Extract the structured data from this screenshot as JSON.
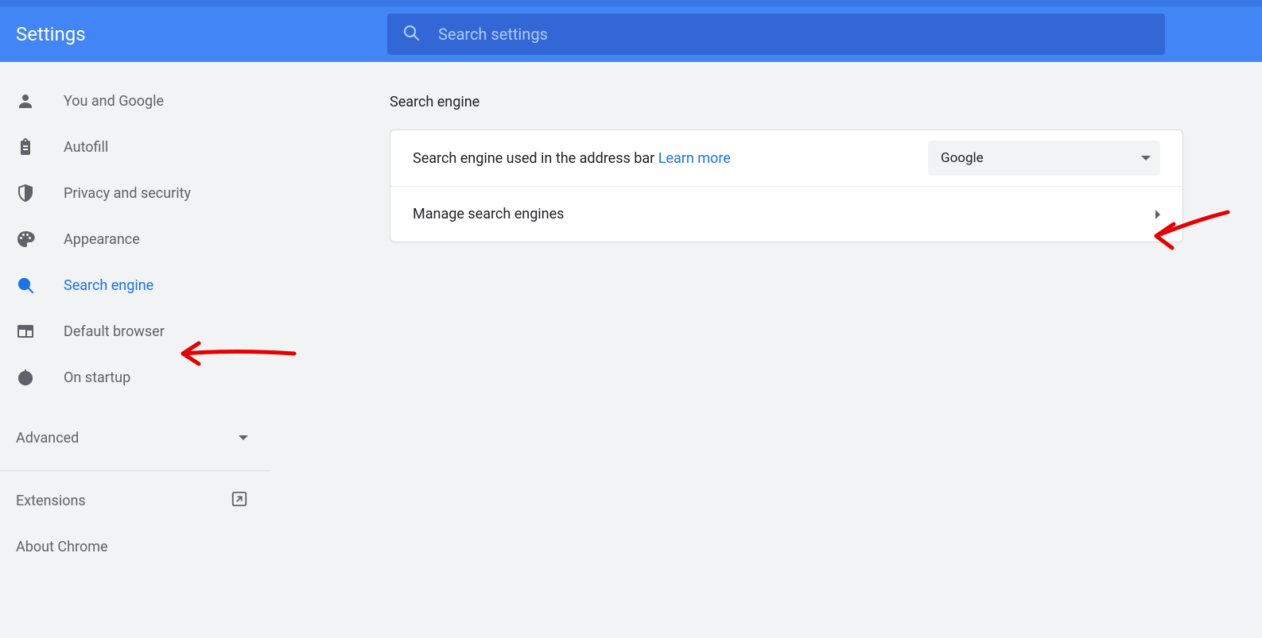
{
  "header": {
    "title": "Settings",
    "search_placeholder": "Search settings"
  },
  "sidebar": {
    "items": [
      {
        "id": "you-and-google",
        "label": "You and Google",
        "icon": "person"
      },
      {
        "id": "autofill",
        "label": "Autofill",
        "icon": "clipboard"
      },
      {
        "id": "privacy",
        "label": "Privacy and security",
        "icon": "shield"
      },
      {
        "id": "appearance",
        "label": "Appearance",
        "icon": "palette"
      },
      {
        "id": "search-engine",
        "label": "Search engine",
        "icon": "search",
        "active": true
      },
      {
        "id": "default-browser",
        "label": "Default browser",
        "icon": "browser"
      },
      {
        "id": "on-startup",
        "label": "On startup",
        "icon": "power"
      }
    ],
    "advanced_label": "Advanced",
    "extensions_label": "Extensions",
    "about_label": "About Chrome"
  },
  "main": {
    "section_title": "Search engine",
    "row1_text": "Search engine used in the address bar",
    "row1_learn_more": "Learn more",
    "row1_dropdown_value": "Google",
    "row2_text": "Manage search engines"
  }
}
